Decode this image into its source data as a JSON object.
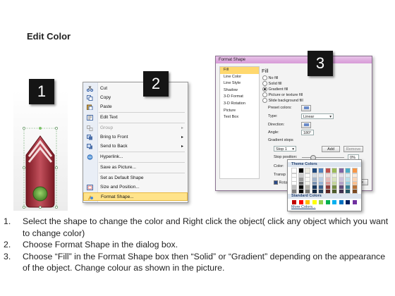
{
  "title": "Edit Color",
  "steps": {
    "s1": "1",
    "s2": "2",
    "s3": "3"
  },
  "context_menu": {
    "items": [
      {
        "label": "Cut",
        "icon": "scissors-icon",
        "disabled": false
      },
      {
        "label": "Copy",
        "icon": "copy-icon",
        "disabled": false
      },
      {
        "label": "Paste",
        "icon": "paste-icon",
        "disabled": false
      },
      {
        "label": "Edit Text",
        "icon": "edit-text-icon",
        "disabled": false
      },
      {
        "label": "Group",
        "icon": "group-icon",
        "disabled": true,
        "submenu": true
      },
      {
        "label": "Bring to Front",
        "icon": "bring-front-icon",
        "disabled": false,
        "submenu": true
      },
      {
        "label": "Send to Back",
        "icon": "send-back-icon",
        "disabled": false,
        "submenu": true
      },
      {
        "label": "Hyperlink...",
        "icon": "hyperlink-icon",
        "disabled": false
      },
      {
        "label": "Save as Picture...",
        "icon": "",
        "disabled": false
      },
      {
        "label": "Set as Default Shape",
        "icon": "",
        "disabled": false
      },
      {
        "label": "Size and Position...",
        "icon": "size-position-icon",
        "disabled": false
      },
      {
        "label": "Format Shape...",
        "icon": "format-shape-icon",
        "disabled": false,
        "highlighted": true
      }
    ]
  },
  "dialog": {
    "title": "Format Shape",
    "nav": [
      "Fill",
      "Line Color",
      "Line Style",
      "Shadow",
      "3-D Format",
      "3-D Rotation",
      "Picture",
      "Text Box"
    ],
    "fill_heading": "Fill",
    "options": [
      "No fill",
      "Solid fill",
      "Gradient fill",
      "Picture or texture fill",
      "Slide background fill"
    ],
    "selected_option": "Gradient fill",
    "preset_colors_label": "Preset colors:",
    "type_label": "Type:",
    "type_value": "Linear",
    "direction_label": "Direction:",
    "angle_label": "Angle:",
    "angle_value": "180°",
    "gradient_stops_label": "Gradient stops",
    "stop_value": "Stop 1",
    "add_button": "Add",
    "remove_button": "Remove",
    "stop_position_label": "Stop position:",
    "stop_position_value": "0%",
    "color_label": "Color:",
    "transparency_label": "Transp",
    "rotate_label": "Rotat",
    "close_button": "se"
  },
  "palette": {
    "theme_label": "Theme Colors",
    "standard_label": "Standard Colors",
    "more_colors_label": "More Colors..."
  },
  "instructions": [
    {
      "num": "1.",
      "text": "Select the shape to change the color and Right click the object( click any object which you want to change color)"
    },
    {
      "num": "2.",
      "text": "Choose Format Shape in the dialog box."
    },
    {
      "num": "3.",
      "text": "Choose “Fill” in the Format Shape box then “Solid” or “Gradient” depending on the appearance of the object. Change colour as shown in the picture."
    }
  ]
}
